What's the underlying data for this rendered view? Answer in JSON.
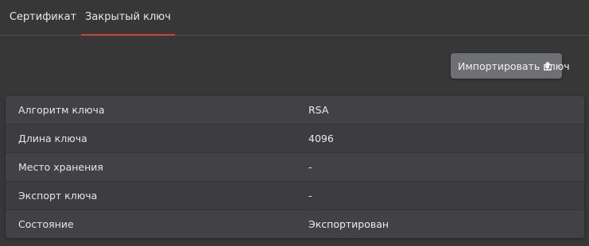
{
  "tabs": [
    {
      "label": "Сертификат",
      "active": false
    },
    {
      "label": "Закрытый ключ",
      "active": true
    }
  ],
  "import_button": {
    "label": "Импортировать ключ",
    "icon": "upload-icon"
  },
  "key_table": {
    "rows": [
      {
        "name": "Алгоритм ключа",
        "value": "RSA"
      },
      {
        "name": "Длина ключа",
        "value": "4096"
      },
      {
        "name": "Место хранения",
        "value": "-"
      },
      {
        "name": "Экспорт ключа",
        "value": "-"
      },
      {
        "name": "Состояние",
        "value": "Экспортирован"
      }
    ]
  },
  "colors": {
    "background": "#373738",
    "active_tab_underline": "#d2443b",
    "button": "#6f7073",
    "table": "#424244"
  }
}
